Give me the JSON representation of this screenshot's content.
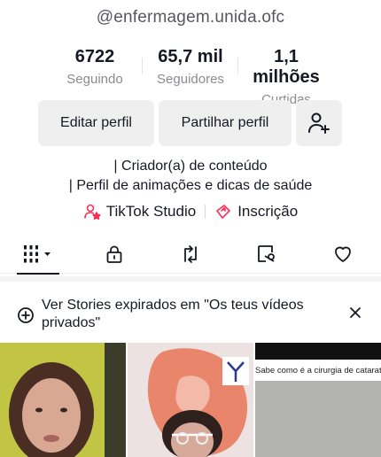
{
  "profile": {
    "handle": "@enfermagem.unida.ofc"
  },
  "stats": [
    {
      "value": "6722",
      "label": "Seguindo"
    },
    {
      "value": "65,7 mil",
      "label": "Seguidores"
    },
    {
      "value": "1,1 milhões",
      "label": "Curtidas"
    }
  ],
  "buttons": {
    "edit": "Editar perfil",
    "share": "Partilhar perfil",
    "add_friend_icon": "add-user-icon"
  },
  "bio": {
    "line1": "| Criador(a) de conteúdo",
    "line2": "| Perfil de animações e dicas  de saúde"
  },
  "links": {
    "studio": "TikTok Studio",
    "subscription": "Inscrição",
    "accent_color": "#fe2c55"
  },
  "tabs": [
    {
      "name": "videos",
      "icon": "grid-icon",
      "active": true
    },
    {
      "name": "private",
      "icon": "lock-icon",
      "active": false
    },
    {
      "name": "reposts",
      "icon": "repost-icon",
      "active": false
    },
    {
      "name": "saved",
      "icon": "bookmark-icon",
      "active": false
    },
    {
      "name": "liked",
      "icon": "heart-icon",
      "active": false
    }
  ],
  "notice": {
    "text": "Ver Stories expirados em \"Os teus vídeos privados\""
  },
  "videos": [
    {
      "thumb": "woman-selfie"
    },
    {
      "thumb": "heart-anatomy-woman"
    },
    {
      "thumb": "catarata",
      "caption": "Sabe como é a cirurgia de catarata?"
    }
  ]
}
